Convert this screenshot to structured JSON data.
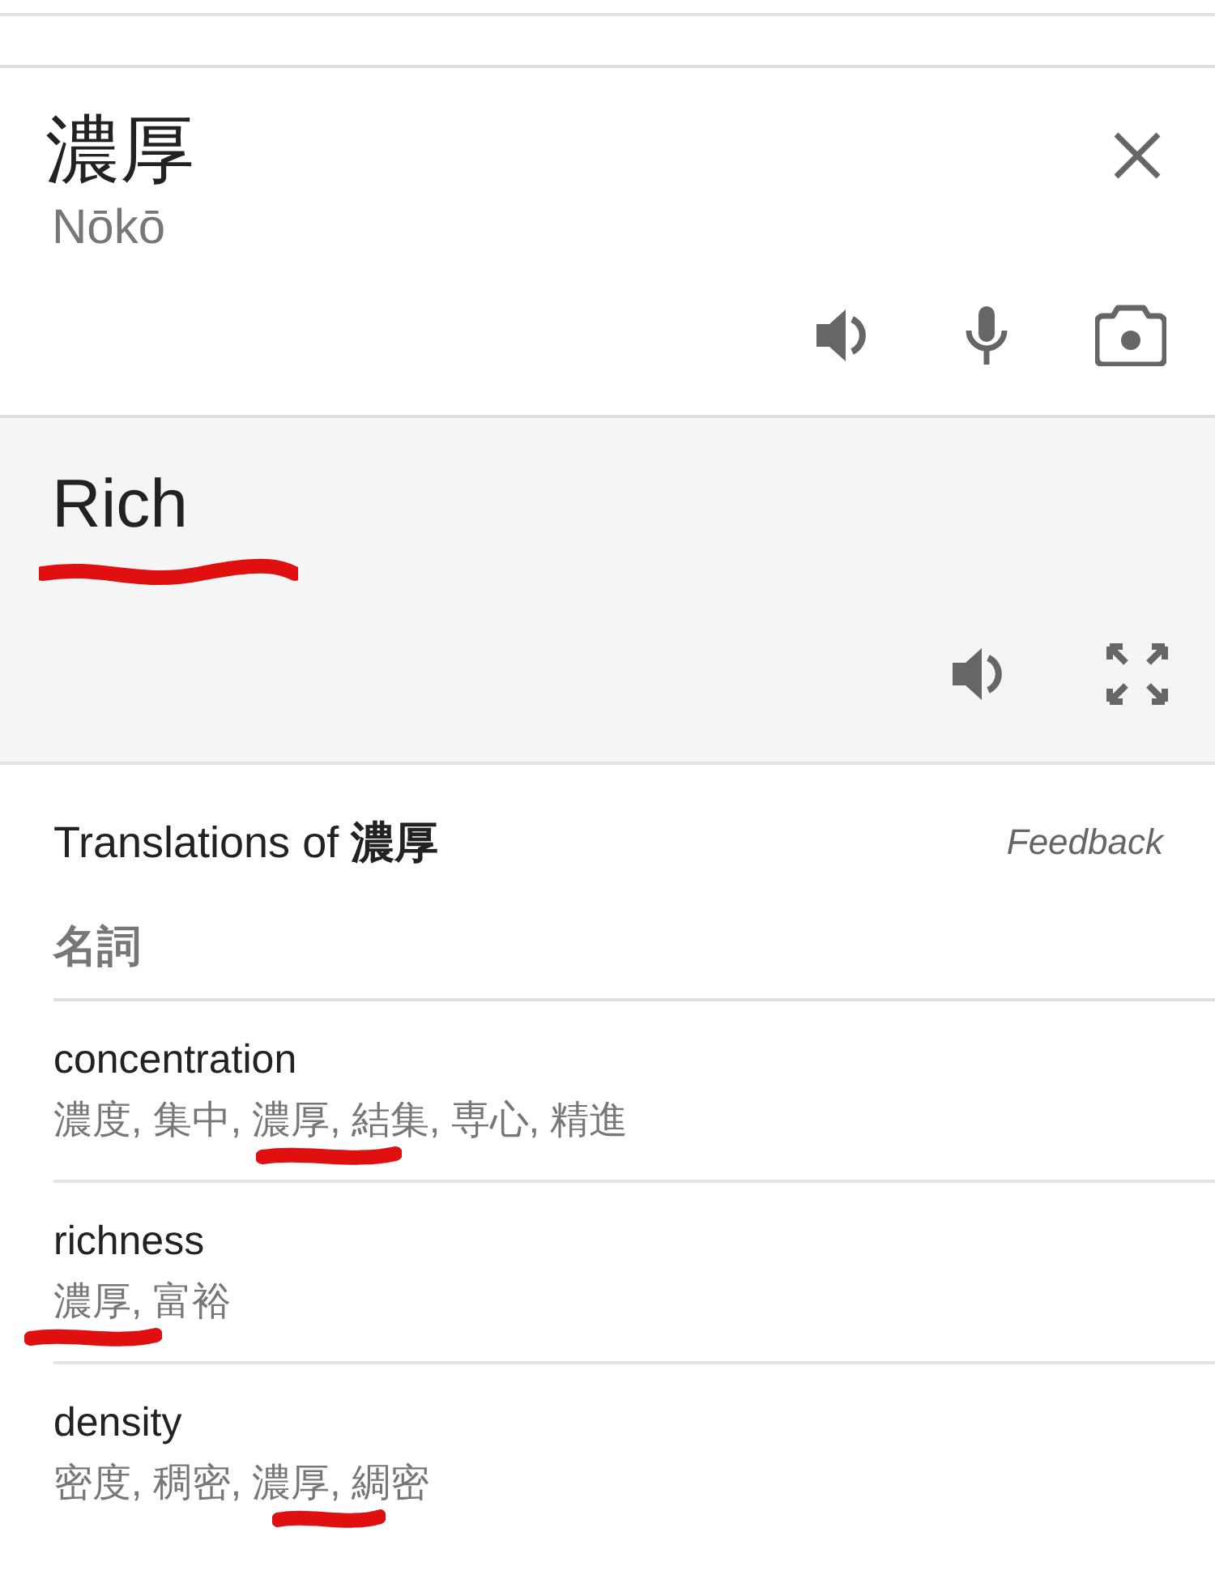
{
  "source": {
    "text": "濃厚",
    "romanization": "Nōkō"
  },
  "target": {
    "text": "Rich"
  },
  "translations": {
    "title": "Translations of **濃厚**",
    "feedback": "Feedback",
    "part_of_speech": "名詞",
    "rows": [
      {
        "word": "concentration",
        "synonyms": "濃度, 集中, 濃厚, 結集, 専心, 精進"
      },
      {
        "word": "richness",
        "synonyms": "濃厚, 富裕"
      },
      {
        "word": "density",
        "synonyms": "密度, 稠密, 濃厚, 綢密"
      }
    ]
  }
}
